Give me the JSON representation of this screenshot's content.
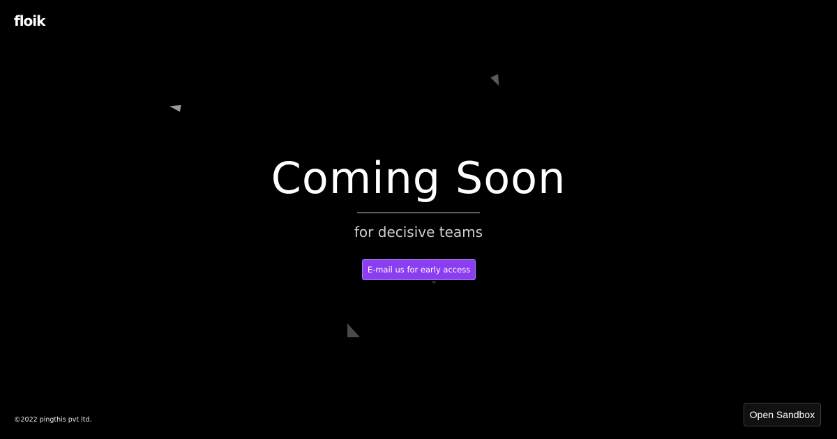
{
  "header": {
    "logo_text": "floik"
  },
  "hero": {
    "title": "Coming Soon",
    "tagline": "for decisive teams",
    "cta_label": "E-mail us for early access"
  },
  "footer": {
    "copyright": "©2022 pingthis pvt ltd.",
    "sandbox_label": "Open Sandbox"
  },
  "colors": {
    "background": "#000000",
    "accent": "#8b3df0",
    "text": "#ffffff"
  }
}
